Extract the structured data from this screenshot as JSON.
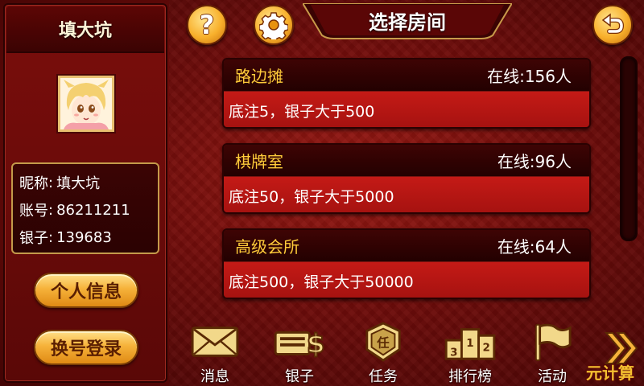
{
  "left": {
    "title": "填大坑",
    "info": [
      {
        "label": "昵称",
        "value": "填大坑"
      },
      {
        "label": "账号",
        "value": "86211211"
      },
      {
        "label": "银子",
        "value": "139683"
      }
    ],
    "separator": ":",
    "profile_button": "个人信息",
    "switch_button": "换号登录"
  },
  "header": {
    "title": "选择房间",
    "help_glyph": "?",
    "icons": {
      "help": "question-icon",
      "settings": "gear-icon",
      "back": "back-arrow-icon"
    }
  },
  "rooms": [
    {
      "name": "路边摊",
      "online": "在线:156人",
      "desc": "底注5，银子大于500"
    },
    {
      "name": "棋牌室",
      "online": "在线:96人",
      "desc": "底注50，银子大于5000"
    },
    {
      "name": "高级会所",
      "online": "在线:64人",
      "desc": "底注500，银子大于50000"
    }
  ],
  "nav": [
    {
      "label": "消息",
      "icon": "envelope-icon"
    },
    {
      "label": "银子",
      "icon": "money-icon"
    },
    {
      "label": "任务",
      "icon": "task-badge-icon"
    },
    {
      "label": "排行榜",
      "icon": "podium-icon"
    },
    {
      "label": "活动",
      "icon": "flag-icon"
    }
  ],
  "more_icon": "double-chevron-right-icon",
  "watermark": "元计算",
  "colors": {
    "accent_gold": "#f6b23a",
    "room_name": "#ffcc3a",
    "room_body": "#c41a16",
    "background": "#6e0c0a"
  }
}
